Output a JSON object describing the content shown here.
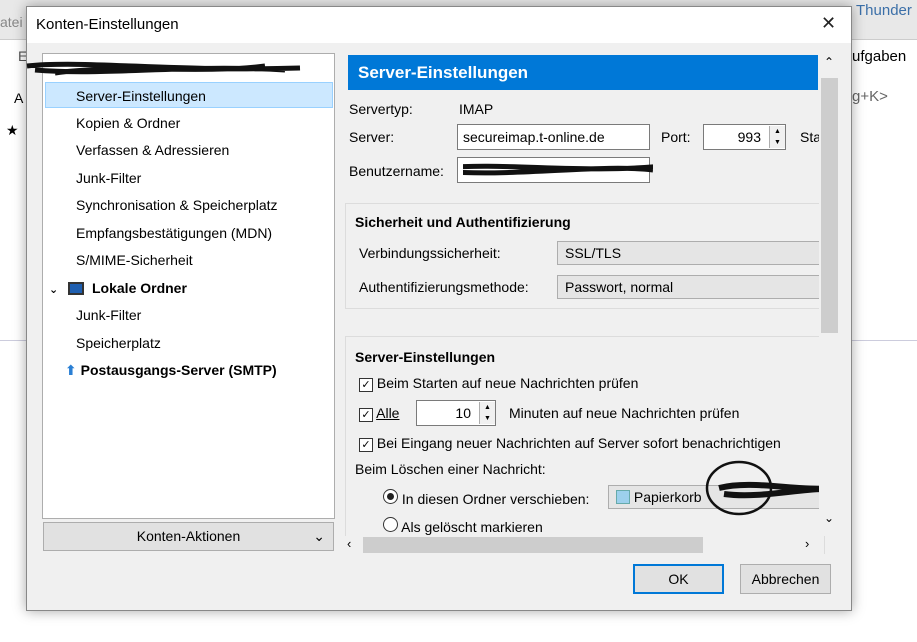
{
  "background_window": {
    "menu_fragment": "atei",
    "title_fragment": "Thunder",
    "tab_fragment": "ufgaben",
    "shortcut_fragment": "g+K>",
    "left_fragments": [
      "E",
      "A"
    ]
  },
  "dialog": {
    "title": "Konten-Einstellungen",
    "close_label": "✕"
  },
  "tree": {
    "items": [
      {
        "label": "Server-Einstellungen",
        "selected": true
      },
      {
        "label": "Kopien & Ordner"
      },
      {
        "label": "Verfassen & Adressieren"
      },
      {
        "label": "Junk-Filter"
      },
      {
        "label": "Synchronisation & Speicherplatz"
      },
      {
        "label": "Empfangsbestätigungen (MDN)"
      },
      {
        "label": "S/MIME-Sicherheit"
      }
    ],
    "local_folders": {
      "label": "Lokale Ordner",
      "children": [
        "Junk-Filter",
        "Speicherplatz"
      ]
    },
    "smtp": {
      "label": "Postausgangs-Server (SMTP)"
    }
  },
  "account_actions_label": "Konten-Aktionen",
  "panel": {
    "header": "Server-Einstellungen",
    "server_type_label": "Servertyp:",
    "server_type_value": "IMAP",
    "server_label": "Server:",
    "server_value": "secureimap.t-online.de",
    "port_label": "Port:",
    "port_value": "993",
    "status_fragment": "Sta",
    "username_label": "Benutzername:",
    "security": {
      "title": "Sicherheit und Authentifizierung",
      "conn_label": "Verbindungssicherheit:",
      "conn_value": "SSL/TLS",
      "auth_label": "Authentifizierungsmethode:",
      "auth_value": "Passwort, normal"
    },
    "server_settings": {
      "title": "Server-Einstellungen",
      "check_startup": "Beim Starten auf neue Nachrichten prüfen",
      "check_every": "Alle",
      "interval": "10",
      "interval_suffix": "Minuten auf neue Nachrichten prüfen",
      "notify": "Bei Eingang neuer Nachrichten auf Server sofort benachrichtigen",
      "delete_label": "Beim Löschen einer Nachricht:",
      "move_label": "In diesen Ordner verschieben:",
      "folder_value": "Papierkorb",
      "mark_label": "Als gelöscht markieren"
    }
  },
  "buttons": {
    "ok": "OK",
    "cancel": "Abbrechen"
  }
}
